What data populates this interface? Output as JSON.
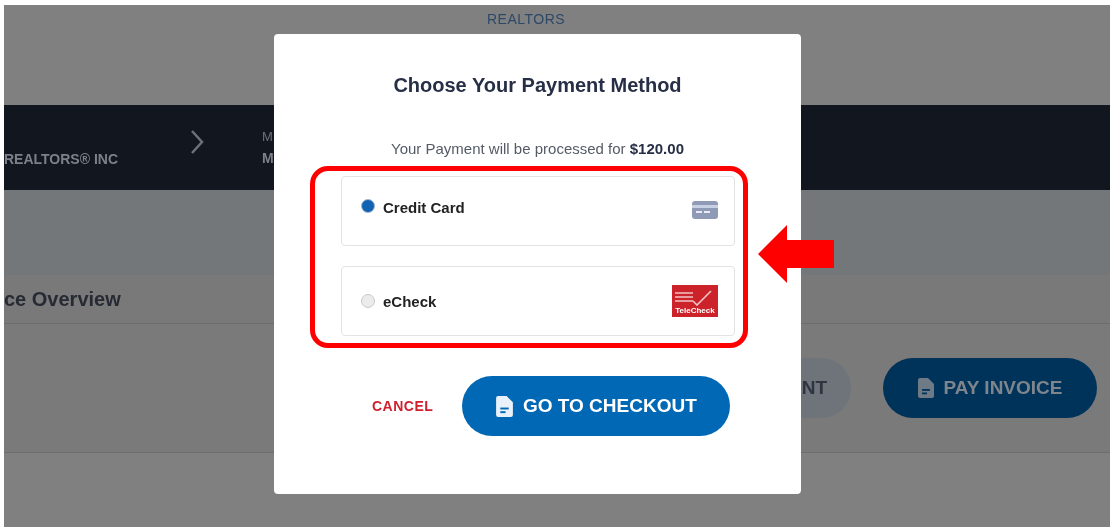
{
  "background": {
    "brand": "REALTORS",
    "breadcrumb": [
      {
        "name": "REALTORS® INC"
      },
      {
        "caption": "M",
        "name": "M"
      }
    ],
    "section_title": "ce Overview",
    "buttons": [
      {
        "label": "NT",
        "kind": "secondary"
      },
      {
        "label": "PAY INVOICE",
        "kind": "primary"
      }
    ]
  },
  "modal": {
    "title": "Choose Your Payment Method",
    "message": "Your Payment will be processed for **$120.00**",
    "options": [
      {
        "label": "Credit Card",
        "selected": true,
        "kind": "card"
      },
      {
        "label": "eCheck",
        "selected": false,
        "kind": "telecheck",
        "logo_text": "TeleCheck"
      }
    ],
    "cancel": "CANCEL",
    "checkout": "GO TO CHECKOUT"
  }
}
